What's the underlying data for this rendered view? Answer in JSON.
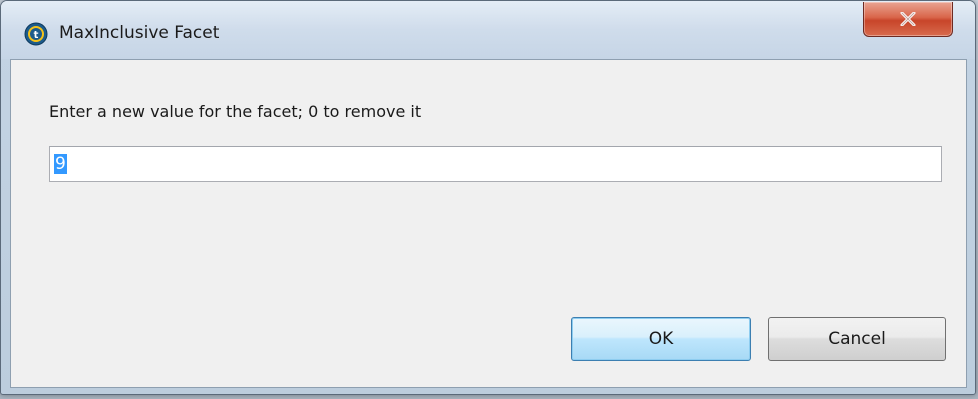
{
  "window": {
    "title": "MaxInclusive Facet",
    "app_icon": "talend-t-icon",
    "close_icon": "close-x-icon"
  },
  "dialog": {
    "prompt": "Enter a new value for the facet; 0 to remove it",
    "input_value": "9",
    "input_selected": true
  },
  "buttons": {
    "ok_label": "OK",
    "cancel_label": "Cancel"
  },
  "colors": {
    "selection": "#3399ff",
    "close_button": "#c8452a",
    "default_button_border": "#3c7fb1"
  }
}
